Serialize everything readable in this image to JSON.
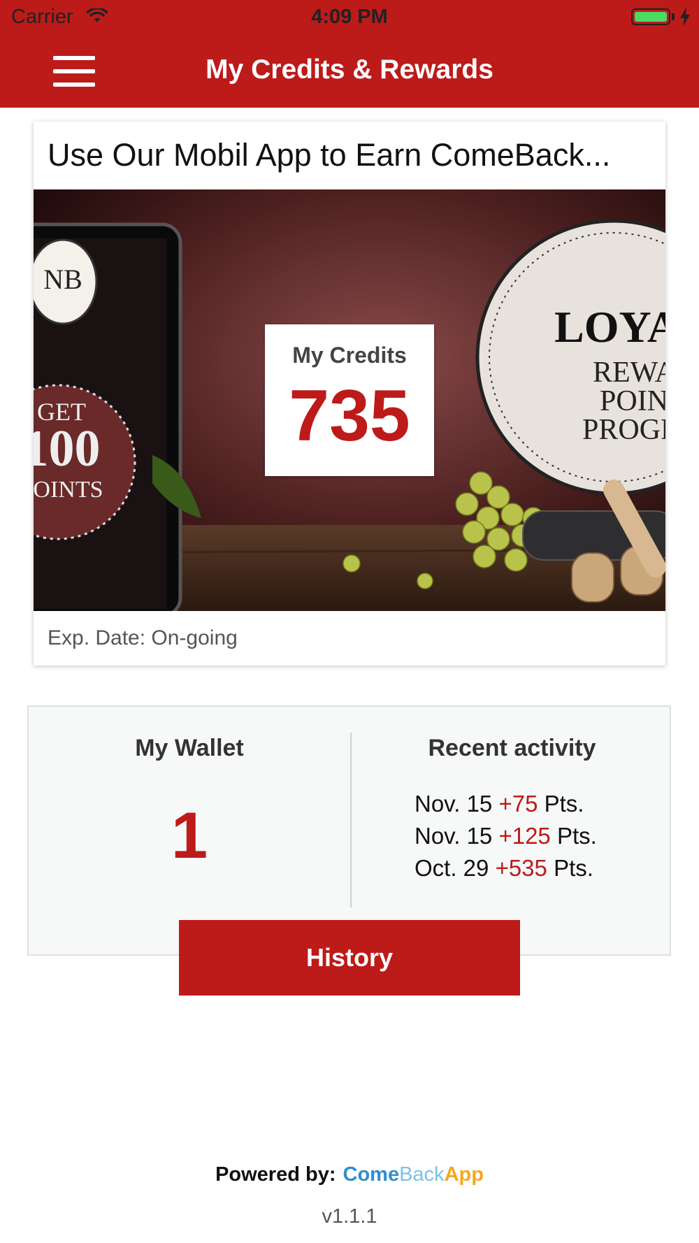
{
  "status_bar": {
    "carrier": "Carrier",
    "time": "4:09 PM",
    "battery_level": 1.0
  },
  "nav": {
    "title": "My Credits & Rewards",
    "menu_icon": "hamburger-menu-icon"
  },
  "offer_card": {
    "title": "Use Our Mobil App to Earn ComeBack...",
    "credits_label": "My Credits",
    "credits_value": "735",
    "exp_date": "Exp. Date: On-going",
    "image_text": {
      "phone_logo": "NB",
      "badge_line1": "GET",
      "badge_line2": "100",
      "badge_line3": "POINTS",
      "seal_line1": "LOYALTY",
      "seal_line2": "REWARD",
      "seal_line3": "POINTS",
      "seal_line4": "PROGRAM"
    }
  },
  "wallet": {
    "title": "My Wallet",
    "value": "1"
  },
  "recent_activity": {
    "title": "Recent activity",
    "items": [
      {
        "date": "Nov. 15",
        "amount": "+75",
        "unit": "Pts."
      },
      {
        "date": "Nov. 15",
        "amount": "+125",
        "unit": "Pts."
      },
      {
        "date": "Oct. 29",
        "amount": "+535",
        "unit": "Pts."
      }
    ]
  },
  "history_button": "History",
  "footer": {
    "powered_by": "Powered by:",
    "brand_come": "Come",
    "brand_back": "Back",
    "brand_app": "App",
    "version": "v1.1.1"
  },
  "colors": {
    "primary_red": "#bd1a1a",
    "brand_blue": "#2f8ecf",
    "brand_light_blue": "#7cc1e8",
    "brand_orange": "#f5a81f"
  }
}
